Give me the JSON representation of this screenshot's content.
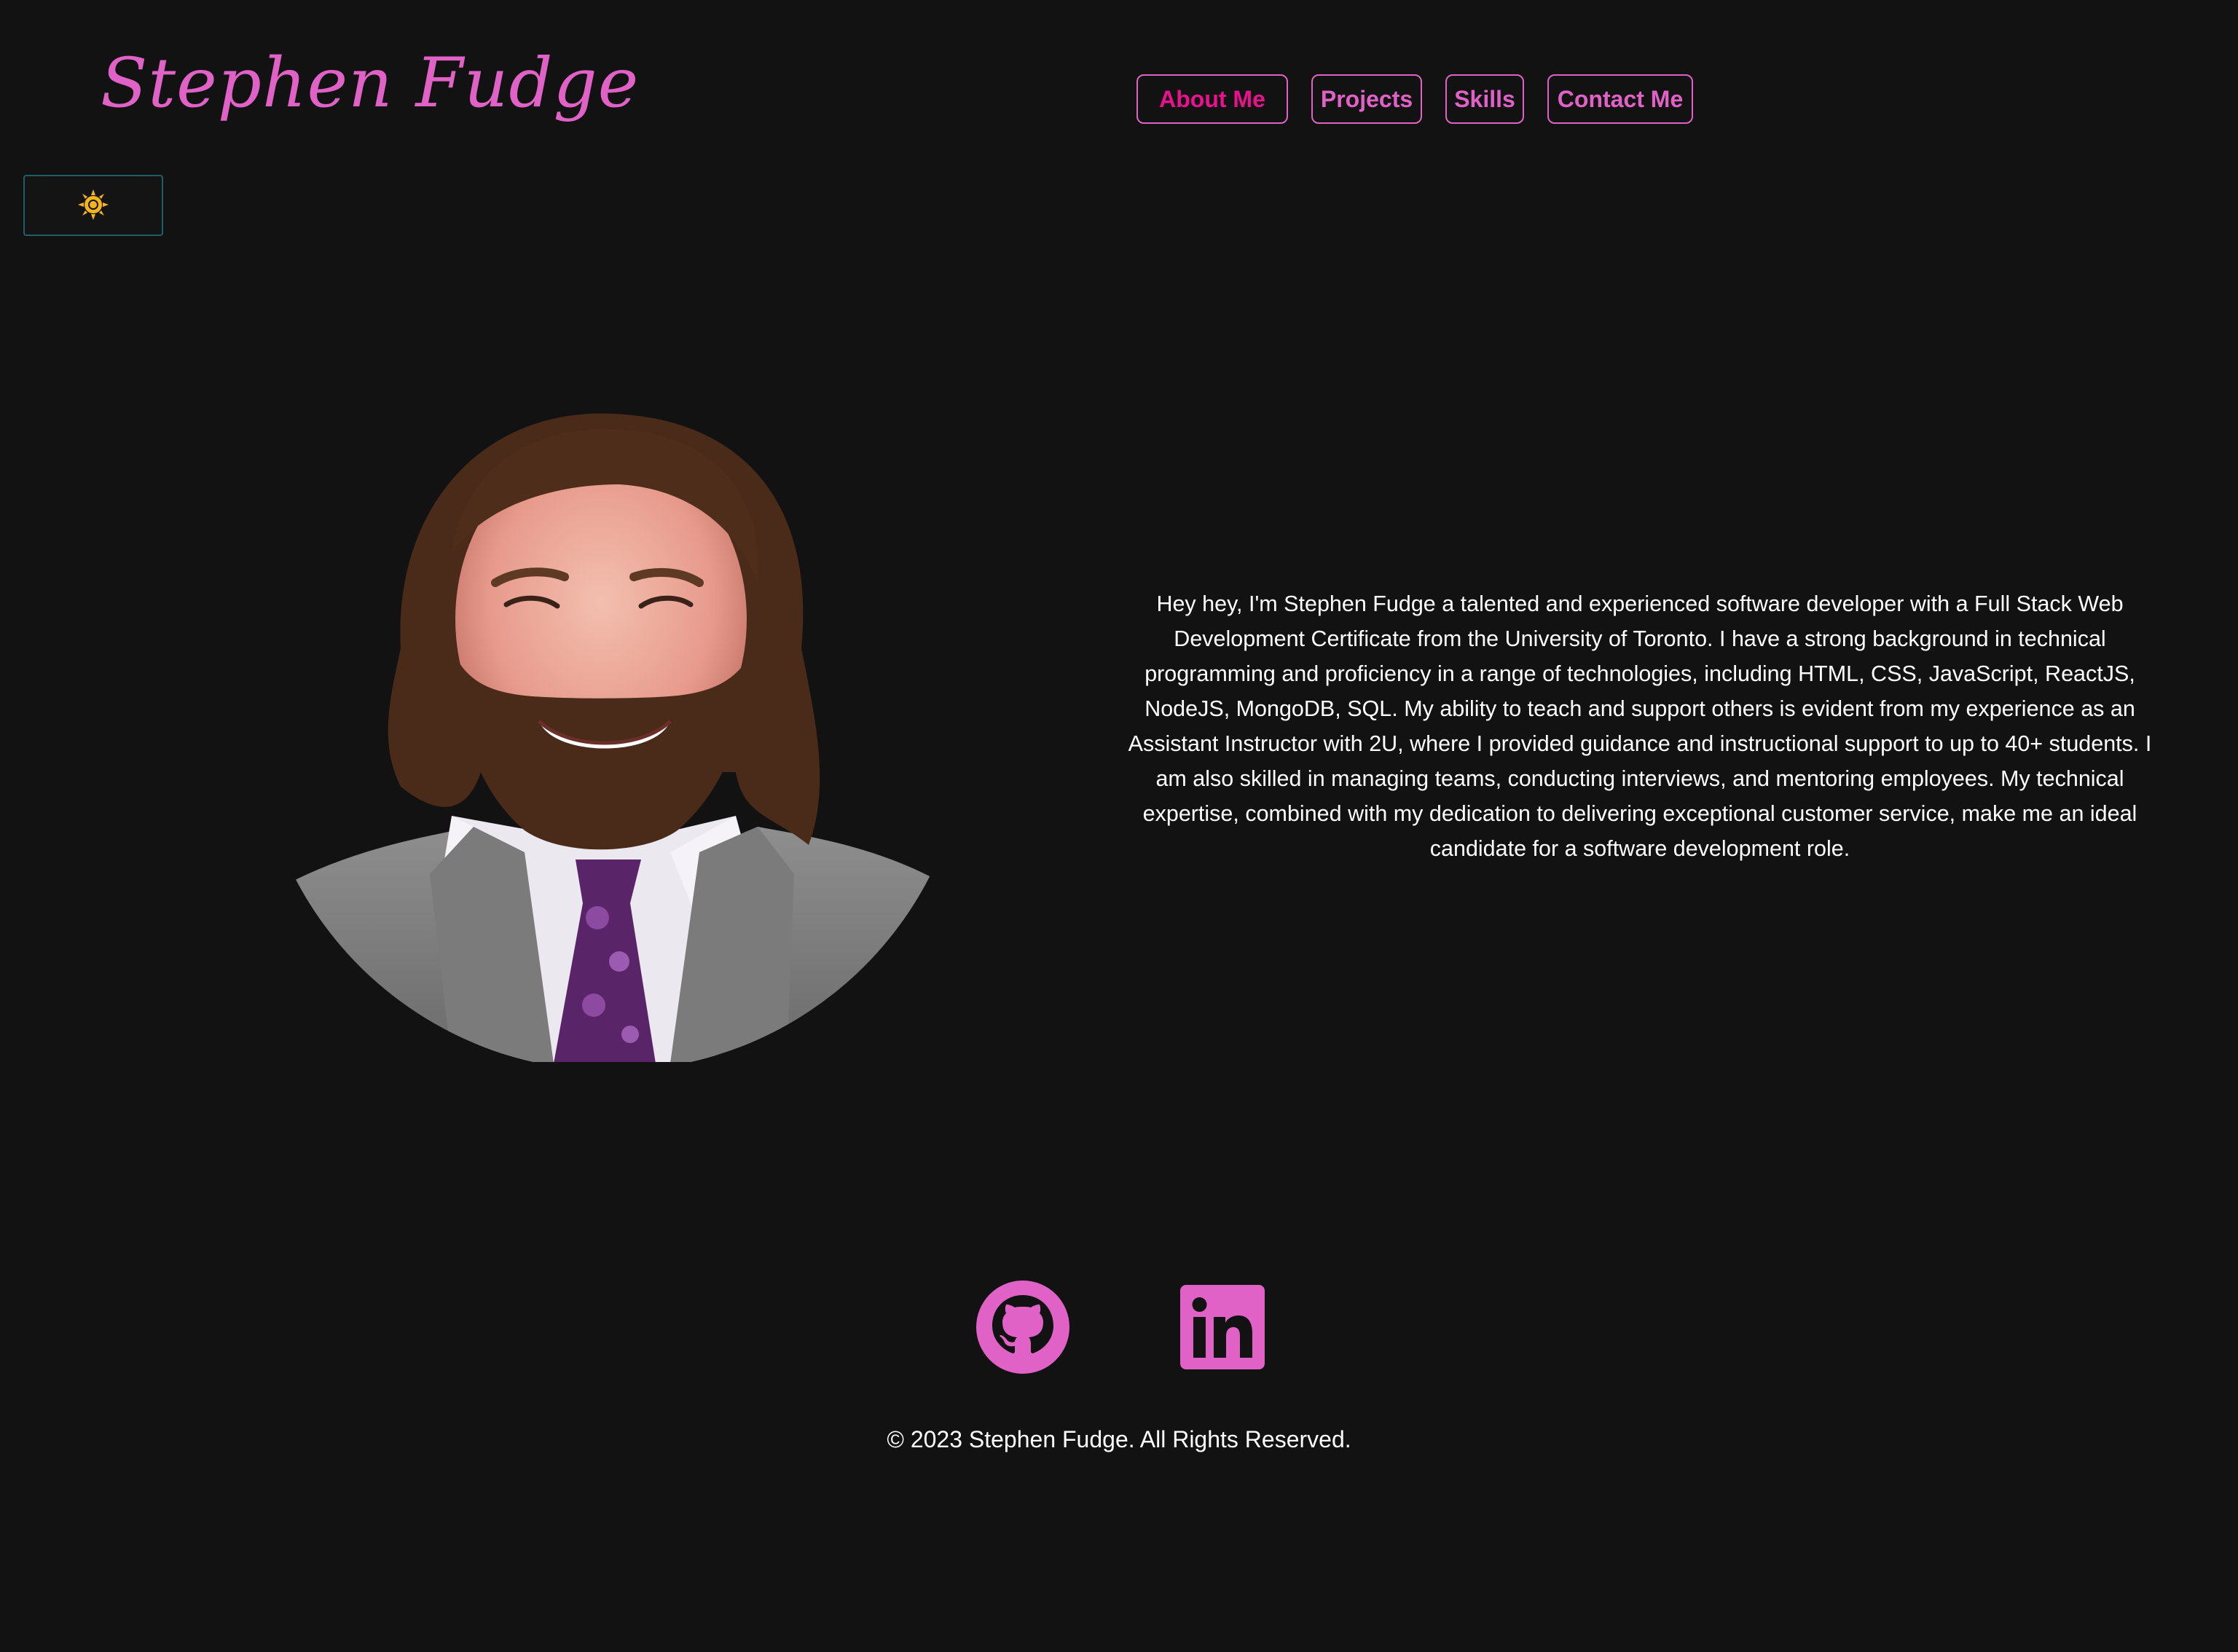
{
  "header": {
    "brand": "Stephen Fudge"
  },
  "nav": {
    "items": [
      {
        "label": "About Me"
      },
      {
        "label": "Projects"
      },
      {
        "label": "Skills"
      },
      {
        "label": "Contact Me"
      }
    ]
  },
  "theme_toggle": {
    "icon": "sun-icon"
  },
  "about": {
    "portrait_icon": "portrait-photo",
    "bio": "Hey hey, I'm Stephen Fudge a talented and experienced software developer with a Full Stack Web Development Certificate from the University of Toronto. I have a strong background in technical programming and proficiency in a range of technologies, including HTML, CSS, JavaScript, ReactJS, NodeJS, MongoDB, SQL. My ability to teach and support others is evident from my experience as an Assistant Instructor with 2U, where I provided guidance and instructional support to up to 40+ students. I am also skilled in managing teams, conducting interviews, and mentoring employees. My technical expertise, combined with my dedication to delivering exceptional customer service, make me an ideal candidate for a software development role."
  },
  "footer": {
    "social": [
      {
        "icon": "github-icon"
      },
      {
        "icon": "linkedin-icon"
      }
    ],
    "copyright": "© 2023 Stephen Fudge. All Rights Reserved."
  },
  "colors": {
    "background": "#121212",
    "accent_pink": "#e062c6",
    "active_nav": "#e8138c",
    "toggle_border": "#1e5e66",
    "sun": "#f2b51d"
  }
}
